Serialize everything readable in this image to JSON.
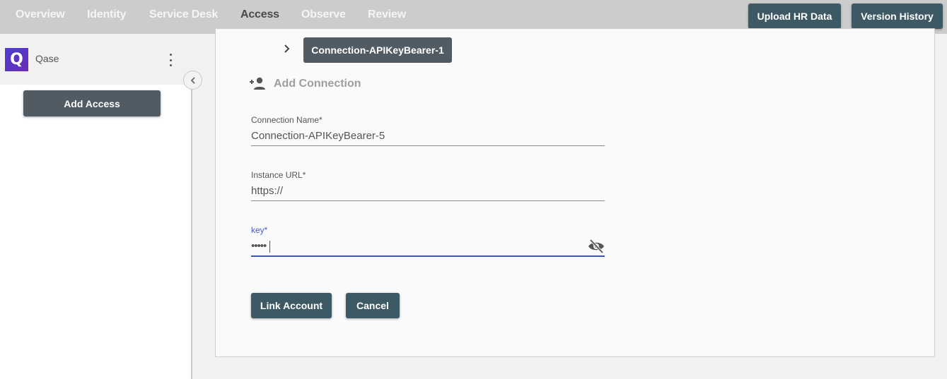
{
  "nav": {
    "tabs": [
      {
        "label": "Overview",
        "active": false
      },
      {
        "label": "Identity",
        "active": false
      },
      {
        "label": "Service Desk",
        "active": false
      },
      {
        "label": "Access",
        "active": true
      },
      {
        "label": "Observe",
        "active": false
      },
      {
        "label": "Review",
        "active": false
      }
    ],
    "upload_hr_label": "Upload HR Data",
    "version_history_label": "Version History"
  },
  "sidebar": {
    "app": {
      "name": "Qase",
      "logo_letter": "Q",
      "logo_color": "#5236c8"
    },
    "add_access_label": "Add Access"
  },
  "main": {
    "existing_connection": "Connection-APIKeyBearer-1",
    "add_connection_label": "Add Connection",
    "form": {
      "connection_name": {
        "label": "Connection Name*",
        "value": "Connection-APIKeyBearer-5"
      },
      "instance_url": {
        "label": "Instance URL*",
        "value": "https://"
      },
      "key": {
        "label": "key*",
        "value": "•••••"
      }
    },
    "link_account_label": "Link Account",
    "cancel_label": "Cancel"
  },
  "colors": {
    "primary_button": "#3d5a64",
    "secondary_button": "#505b63",
    "focus": "#3b54b8",
    "topbar": "#cccccc"
  }
}
